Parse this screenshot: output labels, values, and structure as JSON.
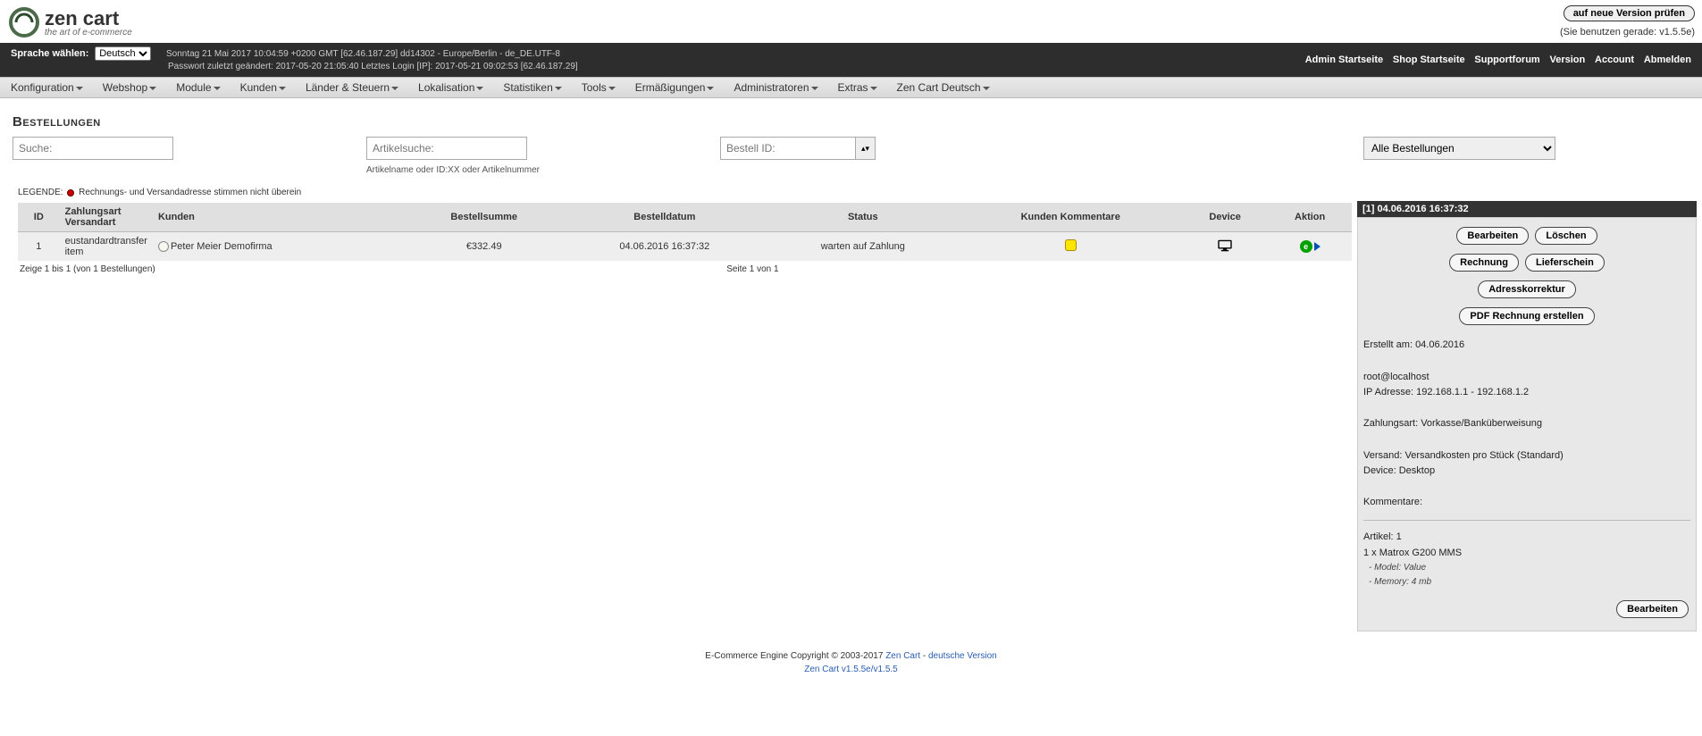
{
  "logo": {
    "title": "zen cart",
    "tagline": "the art of e-commerce"
  },
  "version": {
    "button": "auf neue Version prüfen",
    "note": "(Sie benutzen gerade: v1.5.5e)"
  },
  "lang": {
    "label": "Sprache wählen:",
    "selected": "Deutsch"
  },
  "infobar": {
    "line1": "Sonntag 21 Mai 2017 10:04:59 +0200 GMT [62.46.187.29]   dd14302 - Europe/Berlin - de_DE.UTF-8",
    "line2": "Passwort zuletzt geändert: 2017-05-20 21:05:40   Letztes Login [IP]: 2017-05-21 09:02:53 [62.46.187.29]",
    "links": [
      "Admin Startseite",
      "Shop Startseite",
      "Supportforum",
      "Version",
      "Account",
      "Abmelden"
    ]
  },
  "menu": [
    "Konfiguration",
    "Webshop",
    "Module",
    "Kunden",
    "Länder & Steuern",
    "Lokalisation",
    "Statistiken",
    "Tools",
    "Ermäßigungen",
    "Administratoren",
    "Extras",
    "Zen Cart Deutsch"
  ],
  "page": {
    "title": "Bestellungen",
    "search_ph": "Suche:",
    "artsearch_ph": "Artikelsuche:",
    "art_hint": "Artikelname oder ID:XX oder Artikelnummer",
    "orderid_ph": "Bestell ID:",
    "status_sel": "Alle Bestellungen"
  },
  "legend": {
    "label": "LEGENDE:",
    "text": "Rechnungs- und Versandadresse stimmen nicht überein"
  },
  "table": {
    "h_id": "ID",
    "h_pay": "Zahlungsart Versandart",
    "h_cust": "Kunden",
    "h_total": "Bestellsumme",
    "h_date": "Bestelldatum",
    "h_status": "Status",
    "h_comments": "Kunden Kommentare",
    "h_device": "Device",
    "h_action": "Aktion",
    "rows": [
      {
        "id": "1",
        "pay": "eustandardtransfer item",
        "cust": "Peter Meier Demofirma",
        "total": "€332.49",
        "date": "04.06.2016 16:37:32",
        "status": "warten auf Zahlung"
      }
    ],
    "pager_left": "Zeige 1 bis 1 (von 1 Bestellungen)",
    "pager_right": "Seite 1 von 1"
  },
  "detail": {
    "header": "[1]  04.06.2016 16:37:32",
    "b_edit": "Bearbeiten",
    "b_del": "Löschen",
    "b_inv": "Rechnung",
    "b_slip": "Lieferschein",
    "b_addr": "Adresskorrektur",
    "b_pdf": "PDF Rechnung erstellen",
    "created": "Erstellt am: 04.06.2016",
    "email": "root@localhost",
    "ip": "IP Adresse: 192.168.1.1 - 192.168.1.2",
    "payart": "Zahlungsart: Vorkasse/Banküberweisung",
    "ship": "Versand: Versandkosten pro Stück (Standard)",
    "device": "Device: Desktop",
    "comments": "Kommentare:",
    "articles_head": "Artikel: 1",
    "article_line": "1 x Matrox G200 MMS",
    "attr1": "- Model: Value",
    "attr2": "- Memory: 4 mb",
    "b_edit2": "Bearbeiten"
  },
  "footer": {
    "line1a": "E-Commerce Engine Copyright © 2003-2017 ",
    "link1": "Zen Cart",
    "sep": " - ",
    "link2": "deutsche Version",
    "line2": "Zen Cart v1.5.5e/v1.5.5"
  }
}
